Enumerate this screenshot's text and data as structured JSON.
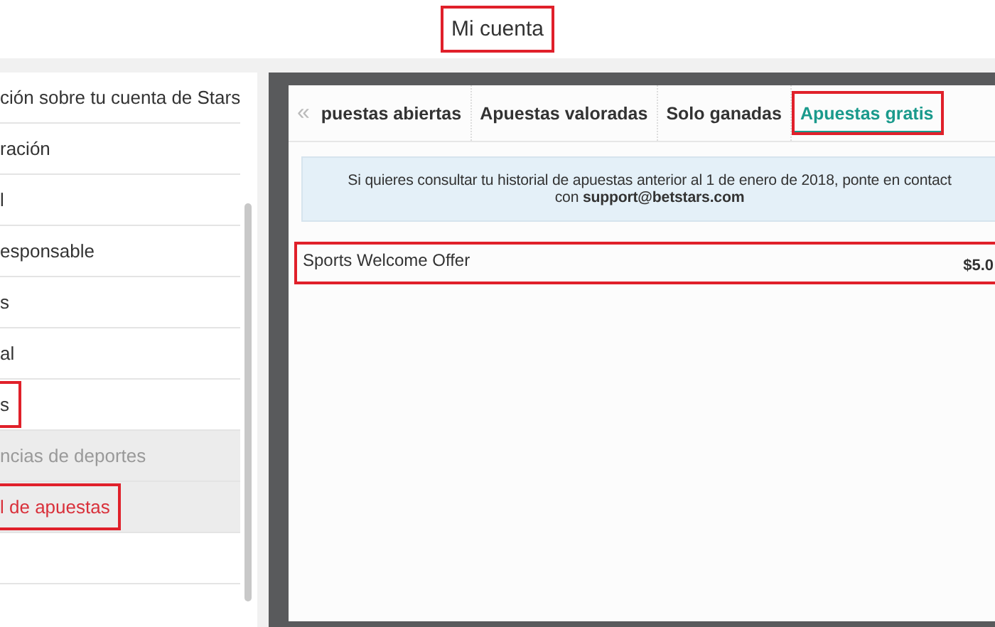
{
  "header": {
    "title": "Mi cuenta",
    "highlighted": true
  },
  "sidebar": {
    "items": [
      {
        "label": "ción sobre tu cuenta de Stars",
        "selected": false,
        "dimmed": false,
        "highlighted": false
      },
      {
        "label": "ración",
        "selected": false,
        "dimmed": false,
        "highlighted": false
      },
      {
        "label": "l",
        "selected": false,
        "dimmed": false,
        "highlighted": false
      },
      {
        "label": "esponsable",
        "selected": false,
        "dimmed": false,
        "highlighted": false
      },
      {
        "label": "s",
        "selected": false,
        "dimmed": false,
        "highlighted": false
      },
      {
        "label": "al",
        "selected": false,
        "dimmed": false,
        "highlighted": false
      },
      {
        "label": "s",
        "selected": false,
        "dimmed": false,
        "highlighted": true
      },
      {
        "label": "ncias de deportes",
        "selected": false,
        "dimmed": true,
        "highlighted": false
      },
      {
        "label": "l de apuestas",
        "selected": true,
        "dimmed": false,
        "highlighted": true
      }
    ]
  },
  "tabs": [
    {
      "label": "puestas abiertas",
      "selected": false,
      "highlighted": false
    },
    {
      "label": "Apuestas valoradas",
      "selected": false,
      "highlighted": false
    },
    {
      "label": "Solo ganadas",
      "selected": false,
      "highlighted": false
    },
    {
      "label": "Apuestas gratis",
      "selected": true,
      "highlighted": true
    }
  ],
  "scroll_left": "«",
  "info": {
    "lines": [
      "Si quieres consultar tu historial de apuestas anterior al 1 de enero de 2018, ponte en contact",
      "con **support@betstars.com**"
    ]
  },
  "offers": [
    {
      "name": "Sports Welcome Offer",
      "amount": "$5.0",
      "highlighted": true
    }
  ]
}
